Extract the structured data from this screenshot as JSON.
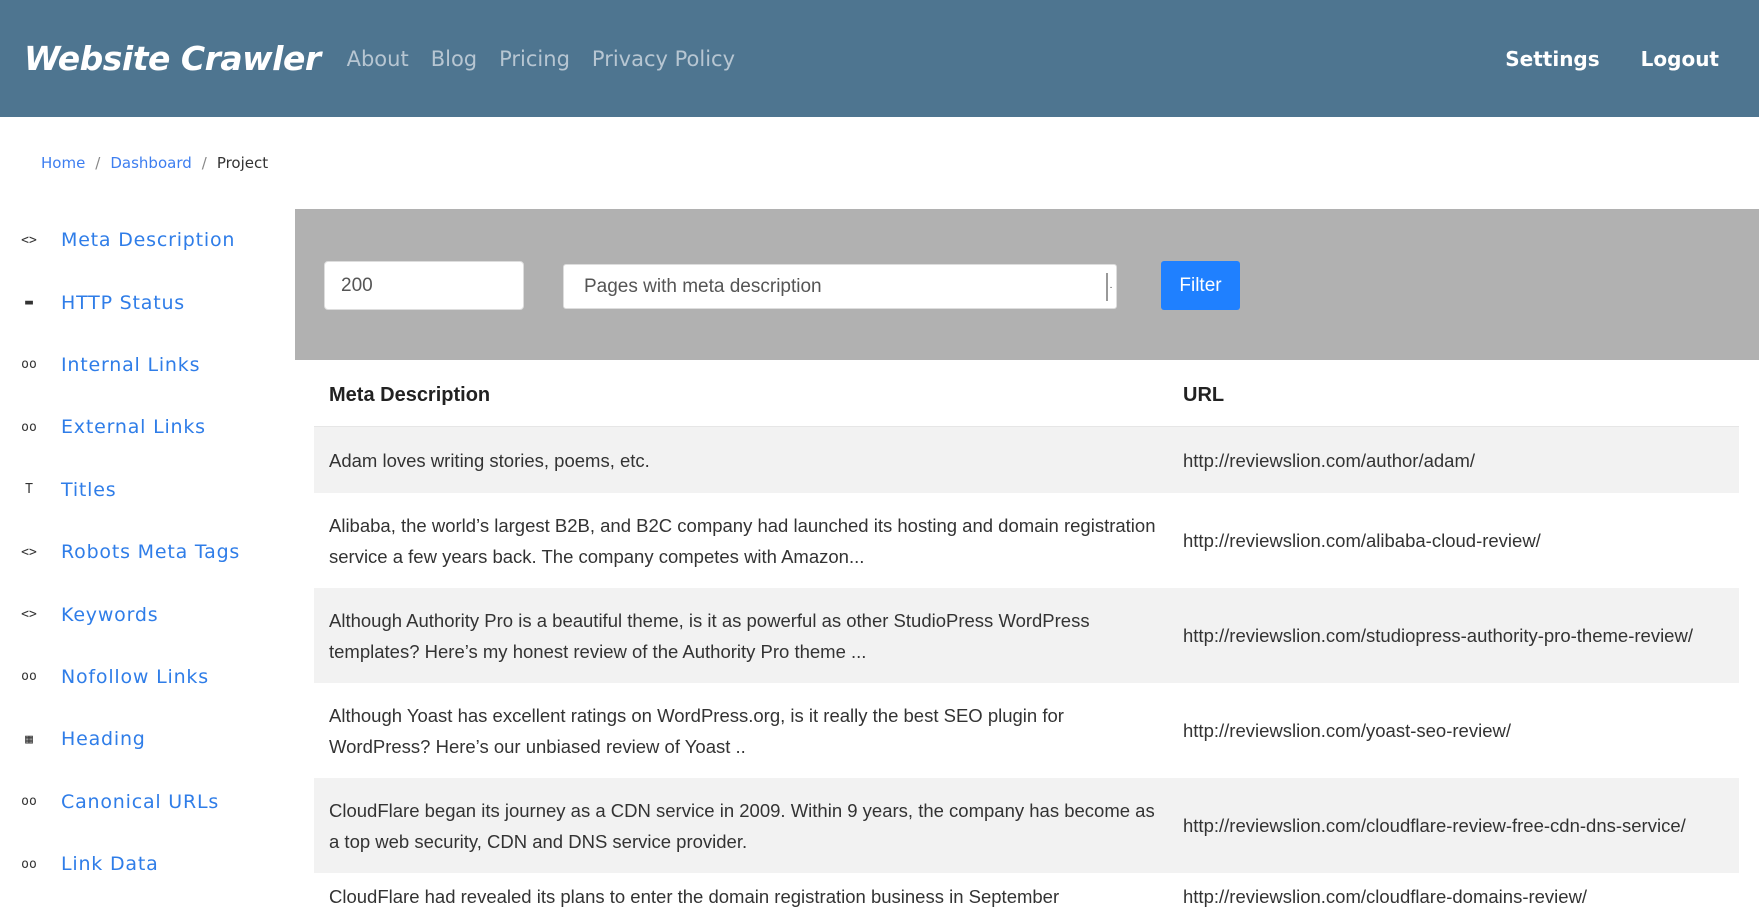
{
  "navbar": {
    "brand": "Website Crawler",
    "links": [
      "About",
      "Blog",
      "Pricing",
      "Privacy Policy"
    ],
    "right": [
      "Settings",
      "Logout"
    ]
  },
  "breadcrumb": {
    "items": [
      "Home",
      "Dashboard"
    ],
    "separator": "/",
    "current": "Project"
  },
  "sidebar": {
    "items": [
      {
        "label": "Meta Description",
        "icon": "code-icon",
        "glyph": "<>"
      },
      {
        "label": "HTTP Status",
        "icon": "server-icon",
        "glyph": "▬"
      },
      {
        "label": "Internal Links",
        "icon": "link-icon",
        "glyph": "oo"
      },
      {
        "label": "External Links",
        "icon": "link-icon",
        "glyph": "oo"
      },
      {
        "label": "Titles",
        "icon": "text-icon",
        "glyph": "T"
      },
      {
        "label": "Robots Meta Tags",
        "icon": "code-icon",
        "glyph": "<>"
      },
      {
        "label": "Keywords",
        "icon": "code-icon",
        "glyph": "<>"
      },
      {
        "label": "Nofollow Links",
        "icon": "link-icon",
        "glyph": "oo"
      },
      {
        "label": "Heading",
        "icon": "heading-icon",
        "glyph": "▦"
      },
      {
        "label": "Canonical URLs",
        "icon": "link-icon",
        "glyph": "oo"
      },
      {
        "label": "Link Data",
        "icon": "link-icon",
        "glyph": "oo"
      }
    ]
  },
  "filter": {
    "input_value": "200",
    "select_value": "Pages with meta description",
    "button_label": "Filter"
  },
  "table": {
    "headers": [
      "Meta Description",
      "URL"
    ],
    "rows": [
      {
        "desc": "Adam loves writing stories, poems, etc.",
        "url": "http://reviewslion.com/author/adam/"
      },
      {
        "desc": "Alibaba, the world’s largest B2B, and B2C company had launched its hosting and domain registration service a few years back. The company competes with Amazon...",
        "url": "http://reviewslion.com/alibaba-cloud-review/"
      },
      {
        "desc": "Although Authority Pro is a beautiful theme, is it as powerful as other StudioPress WordPress templates? Here’s my honest review of the Authority Pro theme ...",
        "url": "http://reviewslion.com/studiopress-authority-pro-theme-review/"
      },
      {
        "desc": "Although Yoast has excellent ratings on WordPress.org, is it really the best SEO plugin for WordPress? Here’s our unbiased review of Yoast ..",
        "url": "http://reviewslion.com/yoast-seo-review/"
      },
      {
        "desc": "CloudFlare began its journey as a CDN service in 2009. Within 9 years, the company has become as a top web security, CDN and DNS service provider.",
        "url": "http://reviewslion.com/cloudflare-review-free-cdn-dns-service/"
      },
      {
        "desc": "CloudFlare had revealed its plans to enter the domain registration business in September",
        "url": "http://reviewslion.com/cloudflare-domains-review/"
      }
    ]
  },
  "colors": {
    "navbar_bg": "#4e7590",
    "link_blue": "#2f7de8",
    "filter_bg": "#b1b1b1",
    "button_blue": "#1f80ff",
    "row_stripe": "#f2f2f2"
  }
}
